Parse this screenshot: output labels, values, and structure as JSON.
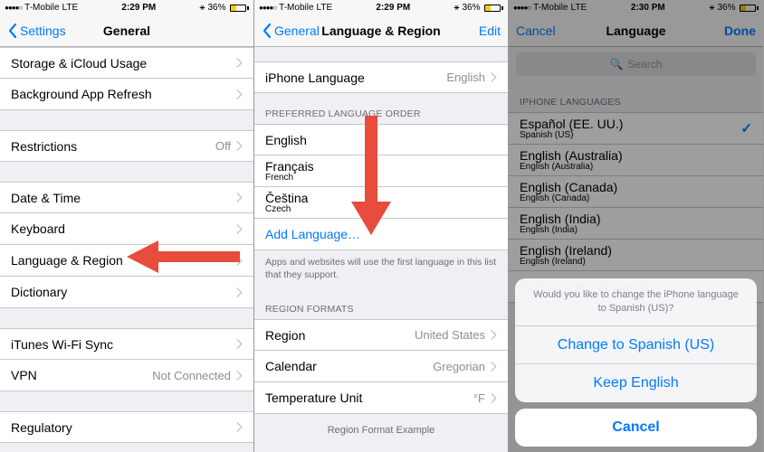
{
  "statusbar": {
    "carrier": "T-Mobile",
    "net": "LTE",
    "time1": "2:29 PM",
    "time2": "2:29 PM",
    "time3": "2:30 PM",
    "battery": "36%"
  },
  "p1": {
    "back": "Settings",
    "title": "General",
    "rows": {
      "storage": "Storage & iCloud Usage",
      "bgrefresh": "Background App Refresh",
      "restrictions": "Restrictions",
      "restrictions_val": "Off",
      "datetime": "Date & Time",
      "keyboard": "Keyboard",
      "langregion": "Language & Region",
      "dictionary": "Dictionary",
      "itunes": "iTunes Wi-Fi Sync",
      "vpn": "VPN",
      "vpn_val": "Not Connected",
      "regulatory": "Regulatory"
    }
  },
  "p2": {
    "back": "General",
    "title": "Language & Region",
    "edit": "Edit",
    "iphone_lang": "iPhone Language",
    "iphone_lang_val": "English",
    "hdr_order": "PREFERRED LANGUAGE ORDER",
    "langs": [
      {
        "label": "English",
        "sub": ""
      },
      {
        "label": "Français",
        "sub": "French"
      },
      {
        "label": "Čeština",
        "sub": "Czech"
      }
    ],
    "add": "Add Language…",
    "footer": "Apps and websites will use the first language in this list that they support.",
    "hdr_formats": "REGION FORMATS",
    "region": "Region",
    "region_val": "United States",
    "calendar": "Calendar",
    "calendar_val": "Gregorian",
    "temp": "Temperature Unit",
    "temp_val": "°F",
    "example": "Region Format Example"
  },
  "p3": {
    "cancel": "Cancel",
    "title": "Language",
    "done": "Done",
    "search": "Search",
    "hdr": "IPHONE LANGUAGES",
    "langs": [
      {
        "label": "Español (EE. UU.)",
        "sub": "Spanish (US)",
        "checked": true
      },
      {
        "label": "English (Australia)",
        "sub": "English (Australia)"
      },
      {
        "label": "English (Canada)",
        "sub": "English (Canada)"
      },
      {
        "label": "English (India)",
        "sub": "English (India)"
      },
      {
        "label": "English (Ireland)",
        "sub": "English (Ireland)"
      },
      {
        "label": "English (New Zealand)",
        "sub": ""
      }
    ],
    "sheet_msg": "Would you like to change the iPhone language to Spanish (US)?",
    "sheet_change": "Change to Spanish (US)",
    "sheet_keep": "Keep English",
    "sheet_cancel": "Cancel"
  }
}
